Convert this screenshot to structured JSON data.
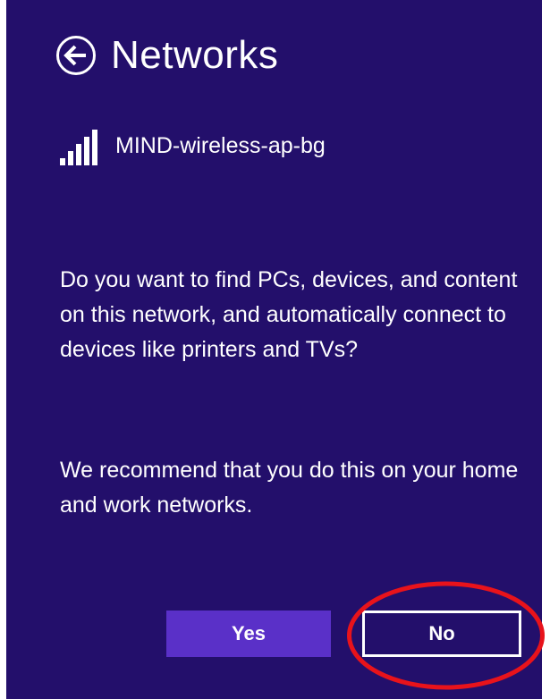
{
  "header": {
    "back_icon": "back-arrow-circle-icon",
    "title": "Networks"
  },
  "network": {
    "icon": "wifi-signal-bars-icon",
    "name": "MIND-wireless-ap-bg"
  },
  "prompt": {
    "question": "Do you want to find PCs, devices, and content on this network, and automatically connect to devices like printers and TVs?",
    "recommendation": "We recommend that you do this on your home and work networks."
  },
  "buttons": {
    "yes_label": "Yes",
    "no_label": "No"
  },
  "colors": {
    "panel_background": "#230f6b",
    "accent_button": "#5a30c8",
    "text": "#ffffff",
    "annotation": "#e8131b"
  }
}
